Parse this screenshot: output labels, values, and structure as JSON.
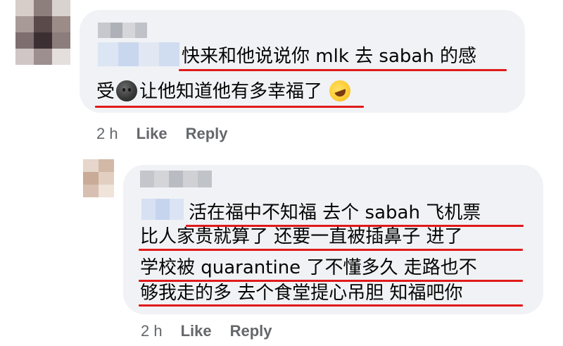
{
  "comments": [
    {
      "lines": [
        "快来和他说说你 mlk 去 sabah 的感",
        "受",
        "让他知道他有多幸福了"
      ],
      "icons": [
        "new-moon-face-emoji",
        "rolling-on-floor-laughing-emoji"
      ],
      "time": "2 h",
      "like_label": "Like",
      "reply_label": "Reply"
    },
    {
      "lines": [
        "活在福中不知福 去个 sabah 飞机票",
        "比人家贵就算了 还要一直被插鼻子 进了",
        "学校被 quarantine 了不懂多久 走路也不",
        "够我走的多 去个食堂提心吊胆 知福吧你"
      ],
      "time": "2 h",
      "like_label": "Like",
      "reply_label": "Reply"
    }
  ],
  "colors": {
    "bubble": "#f0f2f5",
    "text": "#050505",
    "meta": "#65676b",
    "underline": "#e11a1a"
  }
}
